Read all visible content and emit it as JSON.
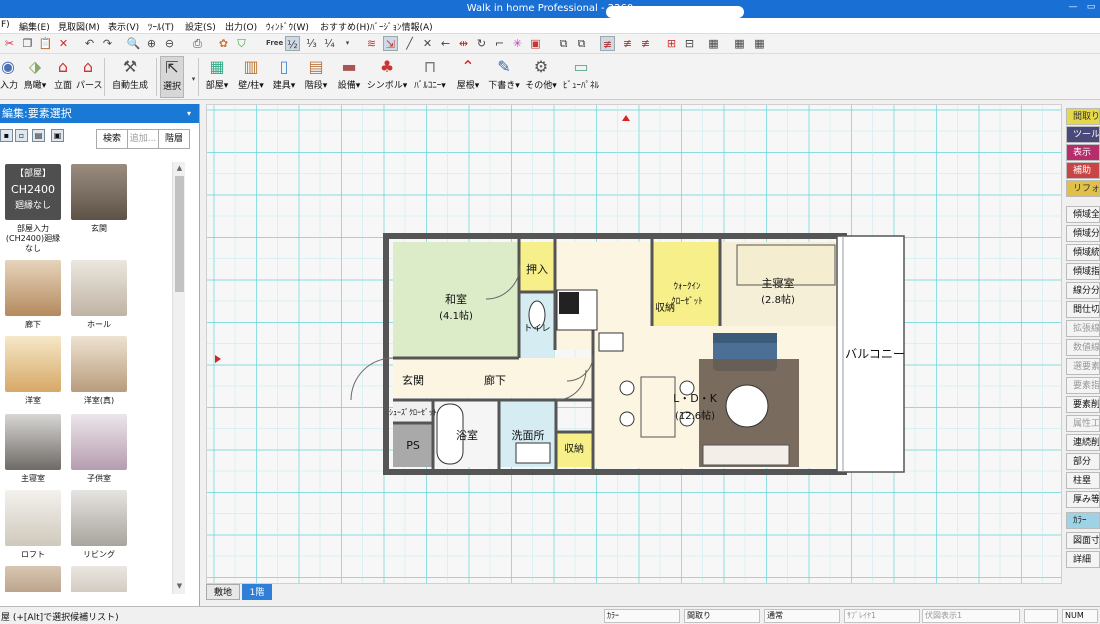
{
  "window": {
    "title": "Walk in home Professional - 2260",
    "controls": [
      "—",
      "▭"
    ]
  },
  "menu": [
    "F)",
    "編集(E)",
    "見取図(M)",
    "表示(V)",
    "ﾂｰﾙ(T)",
    "設定(S)",
    "出力(O)",
    "ｳｨﾝﾄﾞｳ(W)",
    "おすすめ(H)",
    "ﾊﾞｰｼﾞｮﾝ情報(A)"
  ],
  "toolbar1": {
    "free_label": "Free",
    "fractions": [
      "½",
      "⅓",
      "¼"
    ]
  },
  "toolbar2": {
    "items": [
      {
        "label": "入力",
        "icon": "input-icon"
      },
      {
        "label": "鳥瞰▾",
        "icon": "birdseye-icon"
      },
      {
        "label": "立面",
        "icon": "elevation-icon"
      },
      {
        "label": "パース",
        "icon": "perspective-icon"
      },
      {
        "label": "自動生成",
        "icon": "auto-generate-icon"
      },
      {
        "label": "選択",
        "icon": "select-pointer-icon"
      },
      {
        "label": "部屋▾",
        "icon": "room-icon"
      },
      {
        "label": "壁/柱▾",
        "icon": "wall-icon"
      },
      {
        "label": "建具▾",
        "icon": "fixture-icon"
      },
      {
        "label": "階段▾",
        "icon": "stairs-icon"
      },
      {
        "label": "設備▾",
        "icon": "equipment-icon"
      },
      {
        "label": "シンボル▾",
        "icon": "symbol-icon"
      },
      {
        "label": "ﾊﾞﾙｺﾆｰ▾",
        "icon": "balcony-icon"
      },
      {
        "label": "屋根▾",
        "icon": "roof-icon"
      },
      {
        "label": "下書き▾",
        "icon": "draft-icon"
      },
      {
        "label": "その他▾",
        "icon": "other-icon"
      },
      {
        "label": "ﾋﾞｭｰﾊﾟﾈﾙ",
        "icon": "view-panel-icon"
      }
    ]
  },
  "left_panel": {
    "title": "編集:要素選択",
    "buttons": [
      {
        "label": "検索",
        "disabled": false
      },
      {
        "label": "追加...",
        "disabled": true
      },
      {
        "label": "階層",
        "disabled": false
      }
    ],
    "thumbnails": [
      {
        "caption": "部屋入力(CH2400)廻縁なし",
        "card_lines": [
          "【部屋】",
          "CH2400",
          "廻縁なし"
        ],
        "color": "#4f4f4f"
      },
      {
        "caption": "玄関",
        "color": "#7c6d60"
      },
      {
        "caption": "廊下",
        "color": "#c9a37a"
      },
      {
        "caption": "ホール",
        "color": "#d7cfc3"
      },
      {
        "caption": "洋室",
        "color": "#e0c08a"
      },
      {
        "caption": "洋室(真)",
        "color": "#d9c6ad"
      },
      {
        "caption": "主寝室",
        "color": "#8f8c8a"
      },
      {
        "caption": "子供室",
        "color": "#c9b8c4"
      },
      {
        "caption": "ロフト",
        "color": "#e6e2da"
      },
      {
        "caption": "リビング",
        "color": "#c8c6c2"
      },
      {
        "caption": "",
        "color": "#b49a82"
      },
      {
        "caption": "",
        "color": "#d2cbc2"
      }
    ]
  },
  "floorplan": {
    "rooms": [
      {
        "key": "washitsu",
        "label": "和室",
        "area": "(4.1帖)"
      },
      {
        "key": "oshiire",
        "label": "押入"
      },
      {
        "key": "toilet",
        "label": "トイレ"
      },
      {
        "key": "walkin",
        "label": "ｳｫｰｸｲﾝ",
        "sub": "ｸﾛｰｾﾞｯﾄ"
      },
      {
        "key": "storage1",
        "label": "収納"
      },
      {
        "key": "master",
        "label": "主寝室",
        "area": "(2.8帖)"
      },
      {
        "key": "balcony",
        "label": "バルコニー"
      },
      {
        "key": "genkan",
        "label": "玄関"
      },
      {
        "key": "rouka",
        "label": "廊下"
      },
      {
        "key": "ldk",
        "label": "L・D・K",
        "area": "(12.6帖)"
      },
      {
        "key": "shoecloset",
        "label": "ｼｭｰｽﾞｸﾛｰｾﾞｯﾄ"
      },
      {
        "key": "ps",
        "label": "PS"
      },
      {
        "key": "bath",
        "label": "浴室"
      },
      {
        "key": "senmen",
        "label": "洗面所"
      },
      {
        "key": "storage2",
        "label": "収納"
      }
    ]
  },
  "floor_tabs": [
    "敷地",
    "1階"
  ],
  "right_panel": {
    "colored_tabs": [
      {
        "label": "間取り",
        "color": "#e6d84b",
        "text_color": "#333"
      },
      {
        "label": "ツール",
        "color": "#4a4a7a",
        "text_color": "#fff"
      },
      {
        "label": "表示",
        "color": "#b52d6b",
        "text_color": "#fff"
      },
      {
        "label": "補助",
        "color": "#c94545",
        "text_color": "#fff"
      },
      {
        "label": "リフォーム",
        "color": "#e0c04a",
        "text_color": "#333"
      }
    ],
    "buttons": [
      {
        "label": "傾域全",
        "disabled": false
      },
      {
        "label": "傾域分",
        "disabled": false
      },
      {
        "label": "傾域統",
        "disabled": false
      },
      {
        "label": "傾域指",
        "disabled": false
      },
      {
        "label": "線分分",
        "disabled": false
      },
      {
        "label": "間仕切",
        "disabled": false
      },
      {
        "label": "拡張線",
        "disabled": true
      },
      {
        "label": "数値線",
        "disabled": true
      },
      {
        "label": "選要素",
        "disabled": true
      },
      {
        "label": "要素指",
        "disabled": true
      },
      {
        "label": "要素削",
        "disabled": false
      },
      {
        "label": "属性工",
        "disabled": true
      },
      {
        "label": "連続削",
        "disabled": false
      },
      {
        "label": "部分",
        "disabled": false
      },
      {
        "label": "柱塁",
        "disabled": false
      },
      {
        "label": "厚み等",
        "disabled": false
      },
      {
        "label": "ｶﾗｰ",
        "disabled": false,
        "highlight": "#9ed3e6"
      },
      {
        "label": "図面寸",
        "disabled": false
      },
      {
        "label": "詳細",
        "disabled": false
      }
    ]
  },
  "statusbar": {
    "hint": "屋 (+[Alt]で選択候補リスト)",
    "fields": [
      {
        "text": "ｶﾗｰ",
        "dim": false
      },
      {
        "text": "間取り",
        "dim": false
      },
      {
        "text": "通常",
        "dim": false
      },
      {
        "text": "ｻﾌﾞﾚｲﾔ1",
        "dim": true
      },
      {
        "text": "伏図表示1",
        "dim": true
      },
      {
        "text": "",
        "dim": false
      }
    ],
    "num": "NUM"
  }
}
